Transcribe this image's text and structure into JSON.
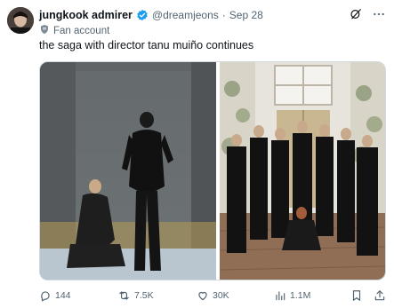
{
  "tweet": {
    "display_name": "jungkook admirer",
    "handle": "@dreamjeons",
    "separator": "·",
    "date": "Sep 28",
    "label": "Fan account",
    "text": "the saga with director tanu muiño continues"
  },
  "actions": {
    "replies": "144",
    "reposts": "7.5K",
    "likes": "30K",
    "views": "1.1M"
  },
  "colors": {
    "verified": "#1d9bf0",
    "muted": "#536471",
    "text": "#0f1419"
  },
  "icons": [
    "verified-badge-icon",
    "grok-icon",
    "more-icon",
    "shield-icon",
    "reply-icon",
    "repost-icon",
    "like-icon",
    "views-icon",
    "bookmark-icon",
    "share-icon"
  ]
}
